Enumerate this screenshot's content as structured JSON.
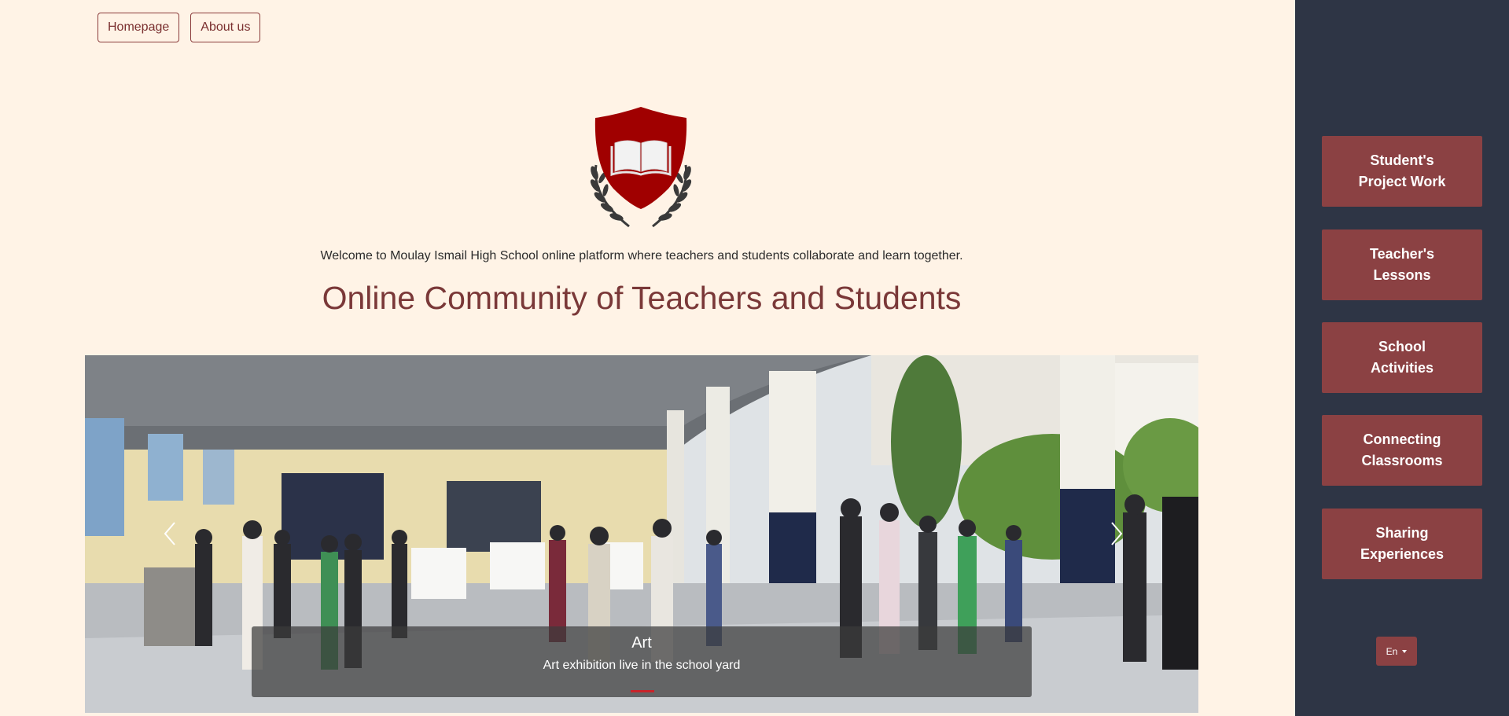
{
  "nav": {
    "homepage": "Homepage",
    "about": "About us"
  },
  "hero": {
    "welcome": "Welcome to Moulay Ismail High School online platform where teachers and students collaborate and learn together.",
    "headline": "Online Community of Teachers and Students"
  },
  "carousel": {
    "caption_title": "Art",
    "caption_text": "Art exhibition live in the school yard",
    "slide_count": 1,
    "active_slide": 1
  },
  "sidebar": {
    "items": [
      {
        "line1": "Student's",
        "line2": "Project Work"
      },
      {
        "line1": "Teacher's",
        "line2": "Lessons"
      },
      {
        "line1": "School",
        "line2": "Activities"
      },
      {
        "line1": "Connecting",
        "line2": "Classrooms"
      },
      {
        "line1": "Sharing",
        "line2": "Experiences"
      }
    ],
    "language": "En"
  },
  "colors": {
    "page_bg": "#fff3e6",
    "sidebar_bg": "#2e3545",
    "accent": "#8b4143",
    "headline": "#7a3838",
    "shield": "#a00000"
  },
  "icons": [
    "book-shield-logo",
    "laurel-wreath",
    "chevron-left-icon",
    "chevron-right-icon",
    "caret-down-icon"
  ]
}
